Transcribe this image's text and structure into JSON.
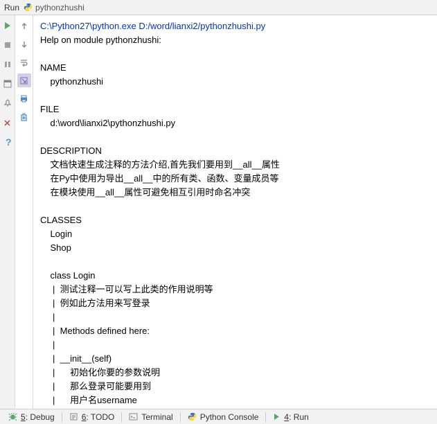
{
  "header": {
    "panel_label": "Run",
    "file_name": "pythonzhushi"
  },
  "console": {
    "command_line": "C:\\Python27\\python.exe D:/word/lianxi2/pythonzhushi.py",
    "lines": [
      "Help on module pythonzhushi:",
      "",
      "NAME",
      "    pythonzhushi",
      "",
      "FILE",
      "    d:\\word\\lianxi2\\pythonzhushi.py",
      "",
      "DESCRIPTION",
      "    文档快速生成注释的方法介绍,首先我们要用到__all__属性",
      "    在Py中使用为导出__all__中的所有类、函数、变量成员等",
      "    在模块使用__all__属性可避免相互引用时命名冲突",
      "",
      "CLASSES",
      "    Login",
      "    Shop",
      "    ",
      "    class Login",
      "     |  测试注释一可以写上此类的作用说明等",
      "     |  例如此方法用来写登录",
      "     |  ",
      "     |  Methods defined here:",
      "     |  ",
      "     |  __init__(self)",
      "     |      初始化你要的参数说明",
      "     |      那么登录可能要用到",
      "     |      用户名username"
    ]
  },
  "footer": {
    "debug": "Debug",
    "debug_key": "5",
    "todo": "TODO",
    "todo_key": "6",
    "terminal": "Terminal",
    "python_console": "Python Console",
    "run": "Run",
    "run_key": "4"
  }
}
